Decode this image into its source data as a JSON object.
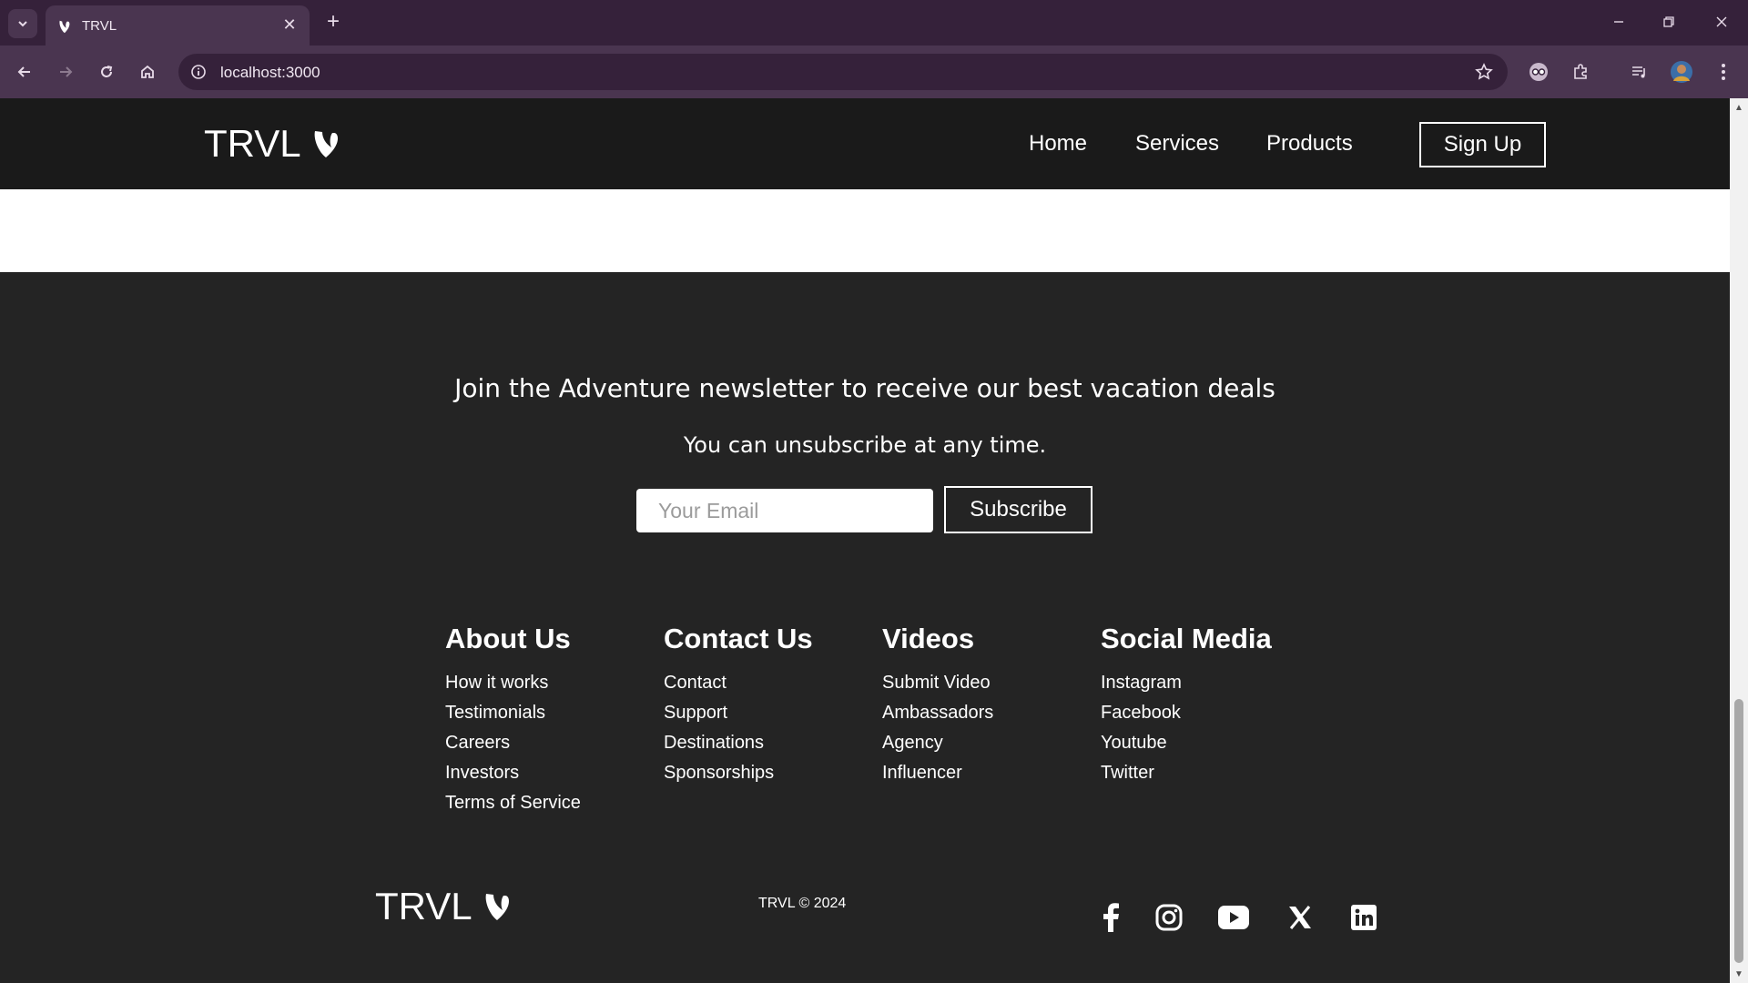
{
  "browser": {
    "tab_title": "TRVL",
    "url": "localhost:3000",
    "colors": {
      "frame": "#35213a",
      "toolbar": "#4a3550"
    }
  },
  "site": {
    "brand": "TRVL",
    "nav": {
      "items": [
        "Home",
        "Services",
        "Products"
      ],
      "signup": "Sign Up"
    },
    "newsletter": {
      "heading": "Join the Adventure newsletter to receive our best vacation deals",
      "subtext": "You can unsubscribe at any time.",
      "email_placeholder": "Your Email",
      "subscribe": "Subscribe"
    },
    "footer": {
      "columns": [
        {
          "title": "About Us",
          "links": [
            "How it works",
            "Testimonials",
            "Careers",
            "Investors",
            "Terms of Service"
          ]
        },
        {
          "title": "Contact Us",
          "links": [
            "Contact",
            "Support",
            "Destinations",
            "Sponsorships"
          ]
        },
        {
          "title": "Videos",
          "links": [
            "Submit Video",
            "Ambassadors",
            "Agency",
            "Influencer"
          ]
        },
        {
          "title": "Social Media",
          "links": [
            "Instagram",
            "Facebook",
            "Youtube",
            "Twitter"
          ]
        }
      ],
      "copyright": "TRVL © 2024",
      "social_icons": [
        "facebook-icon",
        "instagram-icon",
        "youtube-icon",
        "x-icon",
        "linkedin-icon"
      ]
    },
    "colors": {
      "navbar": "#1a1a1a",
      "page": "#242424",
      "text": "#ffffff"
    }
  }
}
